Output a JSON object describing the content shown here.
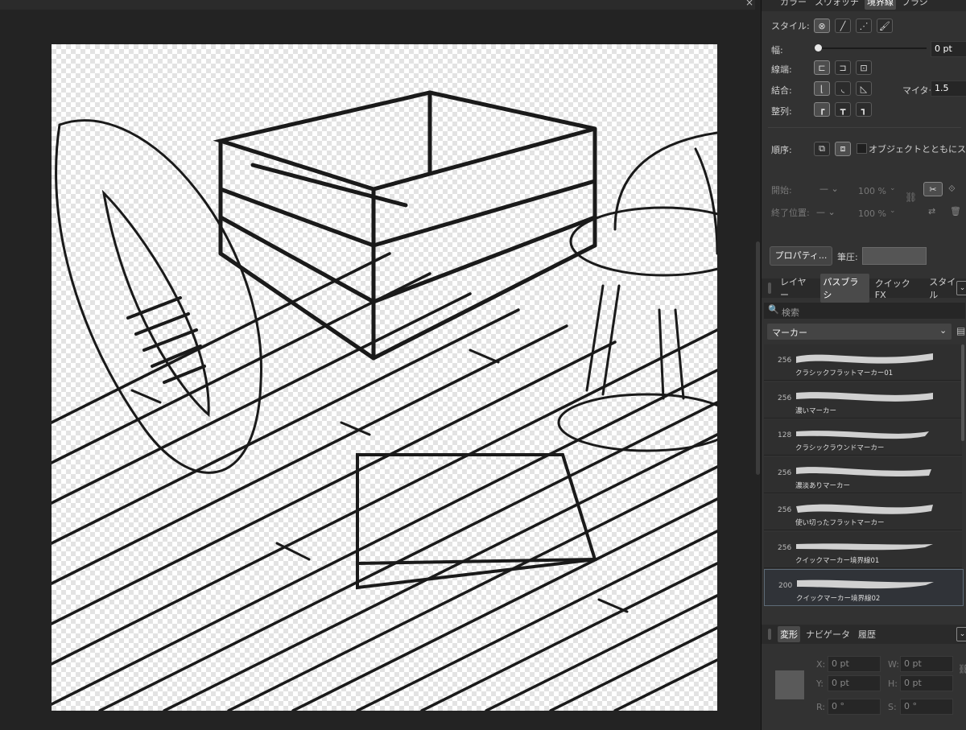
{
  "window": {
    "close_glyph": "×"
  },
  "stroke_panel": {
    "tabs": [
      "カラー",
      "スウォッチ",
      "境界線",
      "ブラシ"
    ],
    "active_tab": "境界線",
    "style_label": "スタイル:",
    "width_label": "幅:",
    "width_value": "0 pt",
    "cap_label": "線端:",
    "join_label": "結合:",
    "miter_label": "マイター:",
    "miter_value": "1.5",
    "align_label": "整列:",
    "order_label": "順序:",
    "scale_with_object_label": "オブジェクトとともにスケーリング",
    "start_label": "開始:",
    "end_label": "終了位置:",
    "start_percent": "100 %",
    "end_percent": "100 %",
    "properties_button": "プロパティ...",
    "pressure_label": "筆圧:"
  },
  "brushes_panel": {
    "tabs": [
      "レイヤー",
      "パスブラシ",
      "クイックFX",
      "スタイル"
    ],
    "active_tab": "パスブラシ",
    "search_placeholder": "検索",
    "category": "マーカー",
    "brushes": [
      {
        "size": "256",
        "name": "クラシックフラットマーカー01",
        "selected": false
      },
      {
        "size": "256",
        "name": "濃いマーカー",
        "selected": false
      },
      {
        "size": "128",
        "name": "クラシックラウンドマーカー",
        "selected": false
      },
      {
        "size": "256",
        "name": "濃淡ありマーカー",
        "selected": false
      },
      {
        "size": "256",
        "name": "使い切ったフラットマーカー",
        "selected": false
      },
      {
        "size": "256",
        "name": "クイックマーカー境界線01",
        "selected": false
      },
      {
        "size": "200",
        "name": "クイックマーカー境界線02",
        "selected": true
      }
    ]
  },
  "transform_panel": {
    "tabs": [
      "変形",
      "ナビゲータ",
      "履歴"
    ],
    "active_tab": "変形",
    "x_label": "X:",
    "x_value": "0 pt",
    "y_label": "Y:",
    "y_value": "0 pt",
    "w_label": "W:",
    "w_value": "0 pt",
    "h_label": "H:",
    "h_value": "0 pt",
    "r_label": "R:",
    "r_value": "0 °",
    "s_label": "S:",
    "s_value": "0 °"
  },
  "colors": {
    "panel_bg": "#323232",
    "workspace_bg": "#232323",
    "selection_border": "#5d6b77"
  }
}
